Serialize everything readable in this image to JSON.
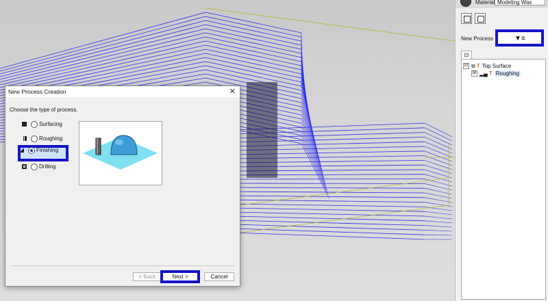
{
  "panel": {
    "material_label": "Material",
    "material_value": "Modeling Wax",
    "new_process_label": "New Process",
    "new_process_glyph": "▼≡",
    "tree": [
      {
        "label": "Top Surface",
        "expander": "⊟"
      },
      {
        "label": "Roughing",
        "expander": "⊞"
      }
    ]
  },
  "dialog": {
    "title": "New Process Creation",
    "close": "✕",
    "prompt": "Choose the type of process.",
    "options": [
      {
        "label": "Surfacing",
        "selected": false
      },
      {
        "label": "Roughing",
        "selected": false
      },
      {
        "label": "Finishing",
        "selected": true
      },
      {
        "label": "Drilling",
        "selected": false
      }
    ],
    "back_label": "< Back",
    "next_label": "Next >",
    "cancel_label": "Cancel"
  },
  "colors": {
    "highlight": "#1414c8",
    "toolpath": "#2a2af0",
    "stock_outline": "#b8b830",
    "preview_plane": "#7fe0f0",
    "preview_dome": "#3f9ed8"
  }
}
